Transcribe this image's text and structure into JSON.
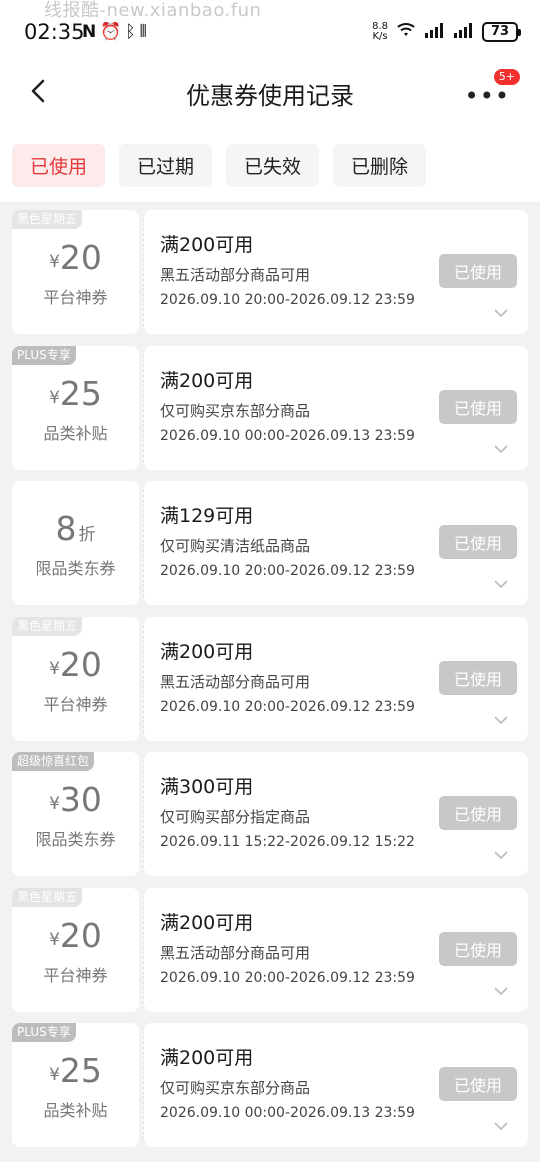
{
  "watermark": "线报酷-new.xianbao.fun",
  "status_bar": {
    "time": "02:35",
    "left_icons": [
      "nfc-icon",
      "alarm-icon",
      "bluetooth-icon",
      "vibrate-icon"
    ],
    "net_speed_value": "8.8",
    "net_speed_unit": "K/s",
    "battery": "73"
  },
  "nav": {
    "title": "优惠券使用记录",
    "badge": "5+"
  },
  "filters": [
    {
      "label": "已使用",
      "active": true
    },
    {
      "label": "已过期",
      "active": false
    },
    {
      "label": "已失效",
      "active": false
    },
    {
      "label": "已删除",
      "active": false
    }
  ],
  "coupons": [
    {
      "tag": "黑色星期五",
      "tag_faint": true,
      "currency": "¥",
      "amount": "20",
      "unit": "",
      "name": "平台神券",
      "condition": "满200可用",
      "desc": "黑五活动部分商品可用",
      "date": "2026.09.10 20:00-2026.09.12 23:59",
      "status": "已使用"
    },
    {
      "tag": "PLUS专享",
      "tag_faint": false,
      "currency": "¥",
      "amount": "25",
      "unit": "",
      "name": "品类补贴",
      "condition": "满200可用",
      "desc": "仅可购买京东部分商品",
      "date": "2026.09.10 00:00-2026.09.13 23:59",
      "status": "已使用"
    },
    {
      "tag": "",
      "tag_faint": false,
      "currency": "",
      "amount": "8",
      "unit": "折",
      "name": "限品类东券",
      "condition": "满129可用",
      "desc": "仅可购买清洁纸品商品",
      "date": "2026.09.10 20:00-2026.09.12 23:59",
      "status": "已使用"
    },
    {
      "tag": "黑色星期五",
      "tag_faint": true,
      "currency": "¥",
      "amount": "20",
      "unit": "",
      "name": "平台神券",
      "condition": "满200可用",
      "desc": "黑五活动部分商品可用",
      "date": "2026.09.10 20:00-2026.09.12 23:59",
      "status": "已使用"
    },
    {
      "tag": "超级惊喜红包",
      "tag_faint": false,
      "currency": "¥",
      "amount": "30",
      "unit": "",
      "name": "限品类东券",
      "condition": "满300可用",
      "desc": "仅可购买部分指定商品",
      "date": "2026.09.11 15:22-2026.09.12 15:22",
      "status": "已使用"
    },
    {
      "tag": "黑色星期五",
      "tag_faint": true,
      "currency": "¥",
      "amount": "20",
      "unit": "",
      "name": "平台神券",
      "condition": "满200可用",
      "desc": "黑五活动部分商品可用",
      "date": "2026.09.10 20:00-2026.09.12 23:59",
      "status": "已使用"
    },
    {
      "tag": "PLUS专享",
      "tag_faint": false,
      "currency": "¥",
      "amount": "25",
      "unit": "",
      "name": "品类补贴",
      "condition": "满200可用",
      "desc": "仅可购买京东部分商品",
      "date": "2026.09.10 00:00-2026.09.13 23:59",
      "status": "已使用"
    }
  ],
  "colors": {
    "accent": "#e4393c",
    "badge": "#f23030",
    "used_button": "#c8c8c8"
  }
}
